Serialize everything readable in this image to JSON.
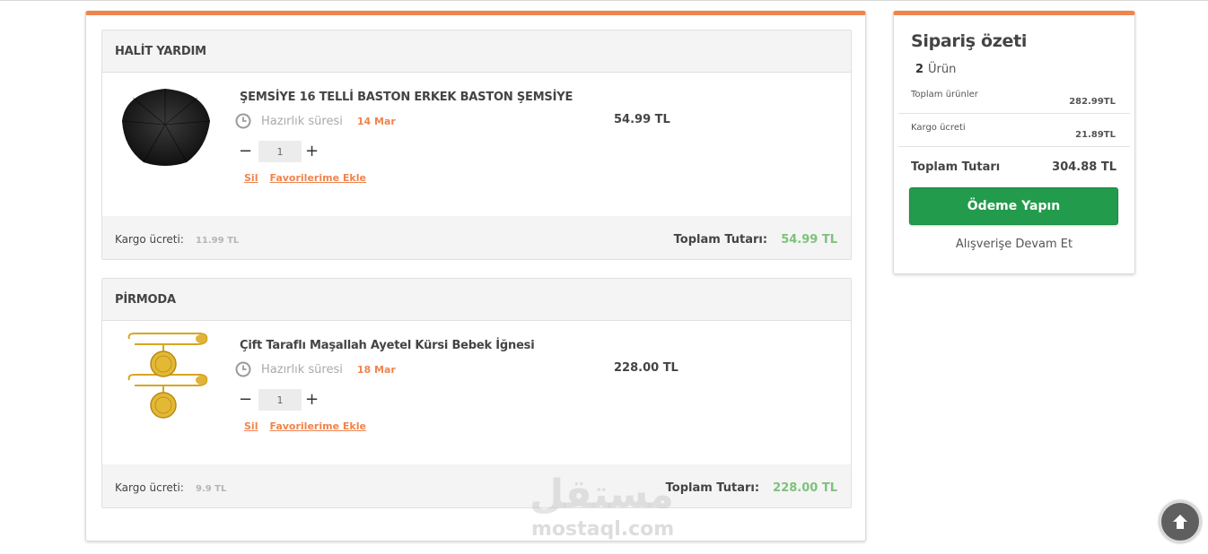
{
  "sellers": [
    {
      "name": "HALİT YARDIM",
      "product": {
        "name": "ŞEMSİYE 16 TELLİ BASTON ERKEK BASTON ŞEMSİYE",
        "prep_label": "Hazırlık süresi",
        "prep_date": "14 Mar",
        "quantity": "1",
        "price": "54.99 TL",
        "image": "umbrella-image"
      },
      "delete_label": "Sil",
      "favorite_label": "Favorilerime Ekle",
      "shipping_label": "Kargo ücreti:",
      "shipping_value": "11.99 TL",
      "total_label": "Toplam Tutarı:",
      "total_value": "54.99 TL"
    },
    {
      "name": "PİRMODA",
      "product": {
        "name": "Çift Taraflı Maşallah Ayetel Kürsi Bebek İğnesi",
        "prep_label": "Hazırlık süresi",
        "prep_date": "18 Mar",
        "quantity": "1",
        "price": "228.00 TL",
        "image": "gold-pin-image"
      },
      "delete_label": "Sil",
      "favorite_label": "Favorilerime Ekle",
      "shipping_label": "Kargo ücreti:",
      "shipping_value": "9.9 TL",
      "total_label": "Toplam Tutarı:",
      "total_value": "228.00 TL"
    }
  ],
  "summary": {
    "title": "Sipariş özeti",
    "count": "2",
    "count_label": "Ürün",
    "products_total_label": "Toplam ürünler",
    "products_total_value": "282.99TL",
    "shipping_label": "Kargo ücreti",
    "shipping_value": "21.89TL",
    "grand_total_label": "Toplam Tutarı",
    "grand_total_value": "304.88 TL",
    "pay_button": "Ödeme Yapın",
    "continue_link": "Alışverişe Devam Et"
  },
  "watermark": {
    "arabic": "مستقل",
    "latin": "mostaql.com"
  },
  "colors": {
    "accent": "#f0844d",
    "pay_button": "#239b4c",
    "total_green": "#7ec27b"
  },
  "icons": {
    "clock": "clock-icon",
    "scroll_top": "arrow-up-icon"
  }
}
